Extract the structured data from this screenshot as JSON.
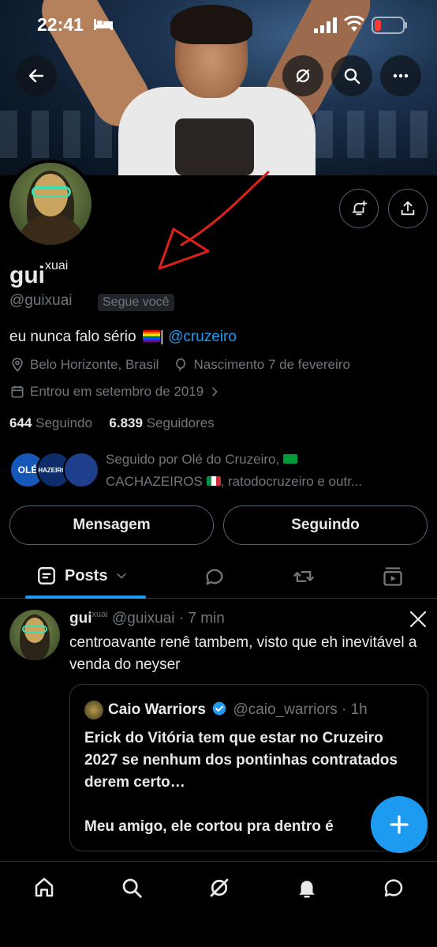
{
  "status_bar": {
    "time": "22:41",
    "icons": [
      "bed-icon",
      "signal-icon",
      "wifi-icon",
      "battery-low-icon"
    ],
    "battery_color": "#ff3b30"
  },
  "header": {
    "buttons": [
      "back-arrow-icon",
      "grok-icon",
      "search-icon",
      "more-icon"
    ]
  },
  "profile": {
    "name": "gui",
    "name_superscript": "xuai",
    "handle": "@guixuai",
    "follows_you": "Segue você",
    "bio_text": "eu nunca falo sério",
    "bio_separator": "|",
    "bio_mention": "@cruzeiro",
    "location": "Belo Horizonte, Brasil",
    "birthday": "Nascimento 7 de fevereiro",
    "joined": "Entrou em setembro de 2019",
    "following_count": "644",
    "following_label": "Seguindo",
    "followers_count": "6.839",
    "followers_label": "Seguidores",
    "followed_by_line1": "Seguido por Olé do Cruzeiro,",
    "followed_by_line2_a": "CACHAZEIROS",
    "followed_by_line2_b": ", ratodocruzeiro e outr...",
    "followed_avatar_1": "OLÉ",
    "followed_avatar_2": "HAZEIROS",
    "message_button": "Mensagem",
    "following_button": "Seguindo",
    "accent_color": "#1d9bf0"
  },
  "tabs": {
    "active": "Posts",
    "items": [
      "posts-icon",
      "replies-icon",
      "reposts-icon",
      "media-icon"
    ]
  },
  "tweet": {
    "name": "gui",
    "name_superscript": "xuai",
    "meta": "@guixuai · 7 min",
    "text": "centroavante renê tambem, visto que eh inevitável a venda do neyser",
    "quote": {
      "name": "Caio Warriors",
      "meta": "@caio_warriors · 1h",
      "text_line1": "Erick do Vitória tem que estar no Cruzeiro 2027 se nenhum dos pontinhas contratados derem certo…",
      "text_line2": "Meu amigo, ele cortou pra dentro é"
    }
  },
  "bottom_nav": [
    "home-icon",
    "search-icon",
    "grok-icon",
    "notifications-icon",
    "messages-icon"
  ]
}
